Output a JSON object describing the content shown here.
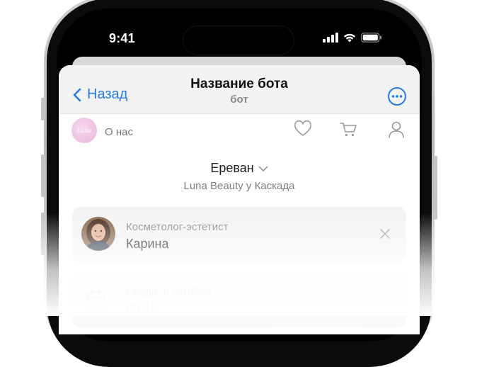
{
  "status_bar": {
    "time": "9:41"
  },
  "nav": {
    "back_label": "Назад",
    "title": "Название бота",
    "subtitle": "бот"
  },
  "top_row": {
    "logo_text": "Luna",
    "about_label": "О нас",
    "icons": [
      "heart-icon",
      "cart-icon",
      "profile-icon"
    ]
  },
  "location": {
    "city": "Ереван",
    "address": "Luna Beauty у Каскада"
  },
  "specialist_card": {
    "role": "Косметолог-эстетист",
    "name": "Карина"
  },
  "date_card": {
    "date": "Среда, 6 октября",
    "time": "09:10"
  },
  "colors": {
    "accent": "#2a7ae4",
    "nav_bg": "#f2f2f2",
    "card_bg": "#f4f4f4"
  }
}
